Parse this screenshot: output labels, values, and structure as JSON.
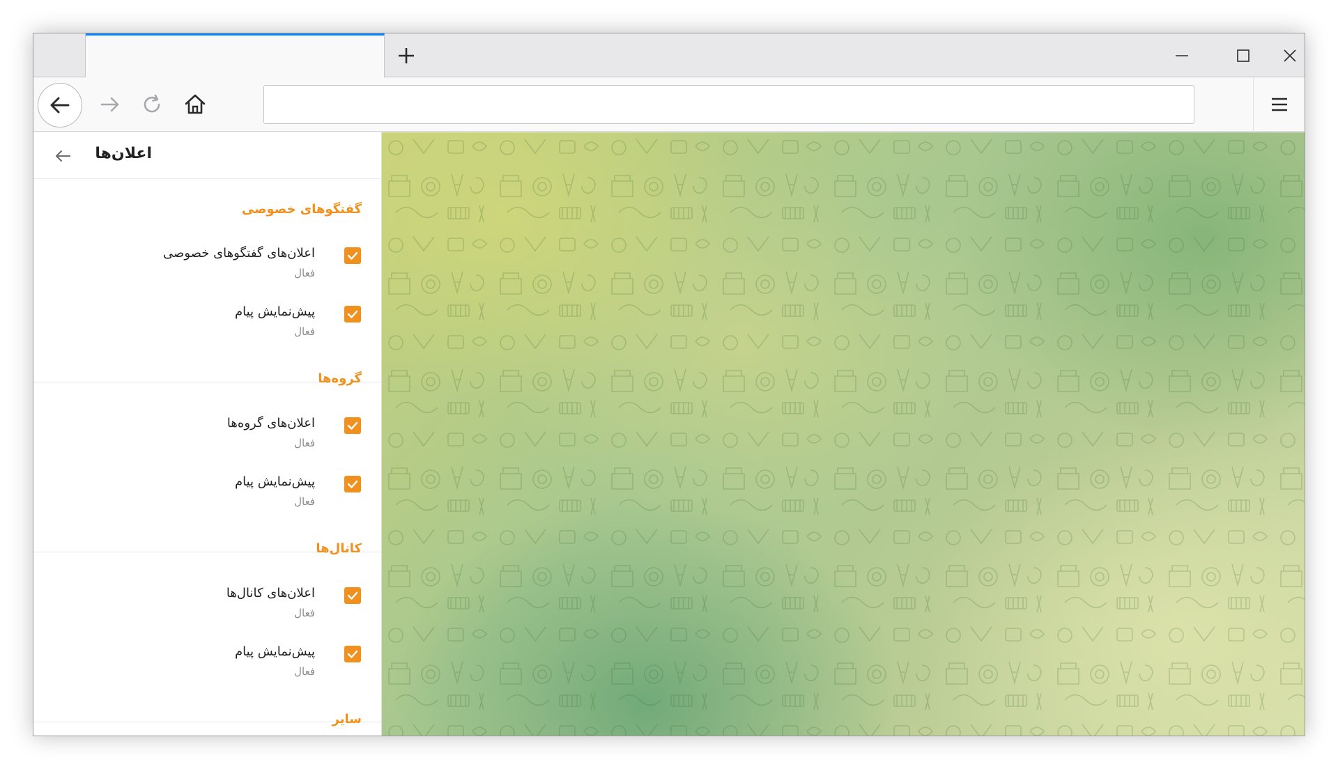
{
  "browser": {
    "url": "",
    "new_tab_label": "+"
  },
  "sidebar": {
    "title": "اعلان‌ها",
    "sections": [
      {
        "title": "گفتگوهای خصوصی",
        "rows": [
          {
            "label": "اعلان‌های گفتگوهای خصوصی",
            "status": "فعال",
            "checked": true
          },
          {
            "label": "پیش‌نمایش پیام",
            "status": "فعال",
            "checked": true
          }
        ]
      },
      {
        "title": "گروه‌ها",
        "rows": [
          {
            "label": "اعلان‌های گروه‌ها",
            "status": "فعال",
            "checked": true
          },
          {
            "label": "پیش‌نمایش پیام",
            "status": "فعال",
            "checked": true
          }
        ]
      },
      {
        "title": "کانال‌ها",
        "rows": [
          {
            "label": "اعلان‌های کانال‌ها",
            "status": "فعال",
            "checked": true
          },
          {
            "label": "پیش‌نمایش پیام",
            "status": "فعال",
            "checked": true
          }
        ]
      },
      {
        "title": "سایر",
        "rows": []
      }
    ]
  },
  "colors": {
    "accent": "#f0901e",
    "tab_indicator": "#0a84ff"
  },
  "icons": {
    "back": "arrow-left-icon",
    "forward": "arrow-right-icon",
    "reload": "reload-icon",
    "home": "home-icon",
    "menu": "hamburger-icon",
    "minimize": "minimize-icon",
    "maximize": "maximize-icon",
    "close": "close-icon",
    "check": "check-icon"
  }
}
